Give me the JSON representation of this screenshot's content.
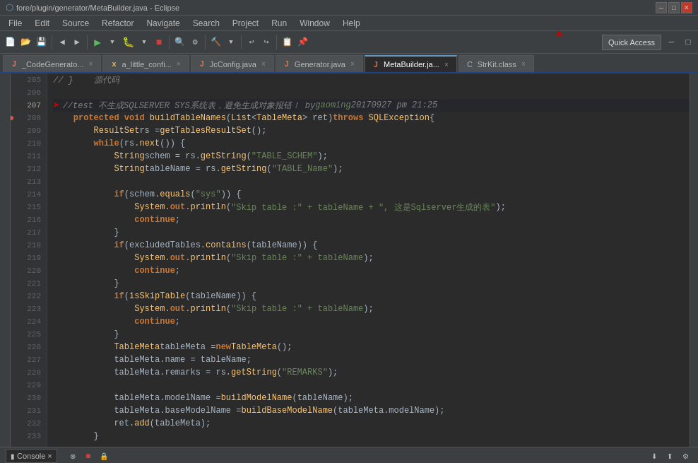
{
  "title_bar": {
    "title": "fore/plugin/generator/MetaBuilder.java - Eclipse",
    "buttons": [
      "minimize",
      "maximize",
      "close"
    ]
  },
  "menu_bar": {
    "items": [
      "File",
      "Edit",
      "Source",
      "Refactor",
      "Navigate",
      "Search",
      "Project",
      "Run",
      "Window",
      "Help"
    ]
  },
  "toolbar": {
    "quick_access_label": "Quick Access"
  },
  "tabs": [
    {
      "id": "codegenerator",
      "label": "_CodeGenerato...",
      "type": "java",
      "active": false
    },
    {
      "id": "alittle",
      "label": "a_little_confi...",
      "type": "xml",
      "active": false
    },
    {
      "id": "jcconfig",
      "label": "JcConfig.java",
      "type": "java",
      "active": false
    },
    {
      "id": "generator",
      "label": "Generator.java",
      "type": "java",
      "active": false
    },
    {
      "id": "metabuilder",
      "label": "MetaBuilder.ja...",
      "type": "java",
      "active": true
    },
    {
      "id": "strkit",
      "label": "StrKit.class",
      "type": "class",
      "active": false
    }
  ],
  "code_lines": [
    {
      "num": 205,
      "content": "// }",
      "comment": true,
      "text": "// }    源代码"
    },
    {
      "num": 206,
      "content": ""
    },
    {
      "num": 207,
      "content": "//test 不生成SQLSERVER SYS系统表，避免生成对象报错！ by gaoming 20170927 pm 21:25",
      "comment": true,
      "arrow": true
    },
    {
      "num": 208,
      "content": "    protected void buildTableNames(List<TableMeta> ret) throws SQLException {",
      "keyword_line": true
    },
    {
      "num": 209,
      "content": "        ResultSet rs = getTablesResultSet();"
    },
    {
      "num": 210,
      "content": "        while (rs.next()) {"
    },
    {
      "num": 211,
      "content": "            String schem = rs.getString(\"TABLE_SCHEM\");"
    },
    {
      "num": 212,
      "content": "            String tableName = rs.getString(\"TABLE_Name\");"
    },
    {
      "num": 213,
      "content": ""
    },
    {
      "num": 214,
      "content": "            if (schem.equals(\"sys\")) {"
    },
    {
      "num": 215,
      "content": "                System.out.println(\"Skip table :\" + tableName + \", 这是Sqlserver生成的表\");"
    },
    {
      "num": 216,
      "content": "                continue;"
    },
    {
      "num": 217,
      "content": "            }"
    },
    {
      "num": 218,
      "content": "            if (excludedTables.contains(tableName)) {"
    },
    {
      "num": 219,
      "content": "                System.out.println(\"Skip table :\" + tableName);"
    },
    {
      "num": 220,
      "content": "                continue;"
    },
    {
      "num": 221,
      "content": "            }"
    },
    {
      "num": 222,
      "content": "            if (isSkipTable(tableName)) {"
    },
    {
      "num": 223,
      "content": "                System.out.println(\"Skip table :\" + tableName);"
    },
    {
      "num": 224,
      "content": "                continue;"
    },
    {
      "num": 225,
      "content": "            }"
    },
    {
      "num": 226,
      "content": "            TableMeta tableMeta = new TableMeta();"
    },
    {
      "num": 227,
      "content": "            tableMeta.name = tableName;"
    },
    {
      "num": 228,
      "content": "            tableMeta.remarks = rs.getString(\"REMARKS\");"
    },
    {
      "num": 229,
      "content": ""
    },
    {
      "num": 230,
      "content": "            tableMeta.modelName = buildModelName(tableName);"
    },
    {
      "num": 231,
      "content": "            tableMeta.baseModelName = buildBaseModelName(tableMeta.modelName);"
    },
    {
      "num": 232,
      "content": "            ret.add(tableMeta);"
    },
    {
      "num": 233,
      "content": "        }"
    }
  ],
  "console": {
    "tab_label": "Console",
    "close_icon": "×"
  }
}
